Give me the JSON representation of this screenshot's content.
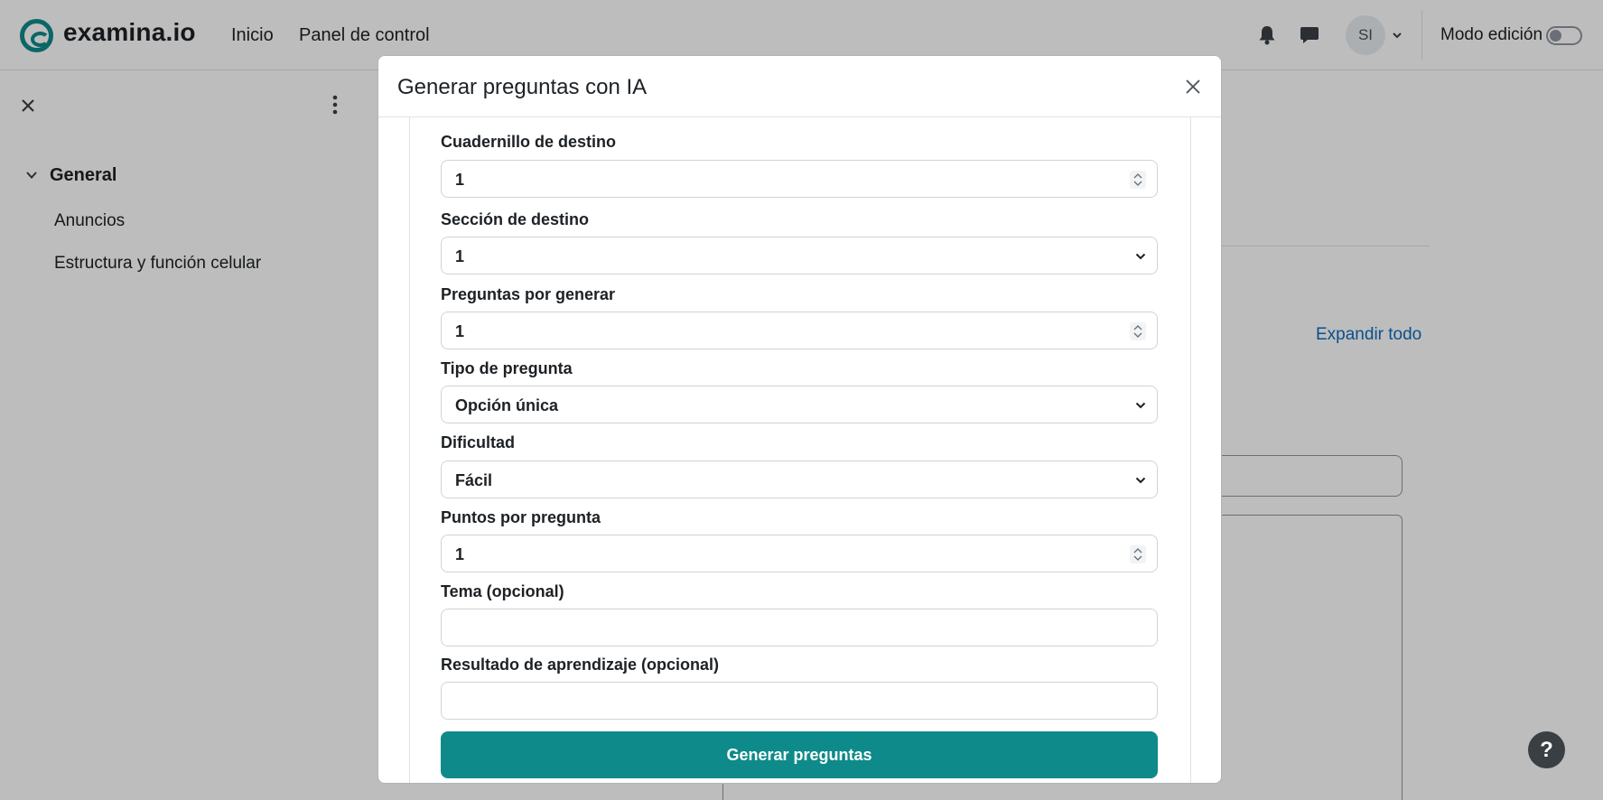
{
  "navbar": {
    "brand": "examina.io",
    "links": [
      "Inicio",
      "Panel de control"
    ],
    "avatar_initials": "SI",
    "edit_mode_label": "Modo edición",
    "accent_color": "#0f8a8a"
  },
  "drawer": {
    "section_title": "General",
    "items": [
      "Anuncios",
      "Estructura y función celular"
    ]
  },
  "page": {
    "expand_all": "Expandir todo"
  },
  "modal": {
    "title": "Generar preguntas con IA",
    "fields": [
      {
        "label": "Cuadernillo de destino",
        "type": "number",
        "value": "1"
      },
      {
        "label": "Sección de destino",
        "type": "select",
        "value": "1"
      },
      {
        "label": "Preguntas por generar",
        "type": "number",
        "value": "1"
      },
      {
        "label": "Tipo de pregunta",
        "type": "select",
        "value": "Opción única"
      },
      {
        "label": "Dificultad",
        "type": "select",
        "value": "Fácil"
      },
      {
        "label": "Puntos por pregunta",
        "type": "number",
        "value": "1"
      },
      {
        "label": "Tema (opcional)",
        "type": "text",
        "value": ""
      },
      {
        "label": "Resultado de aprendizaje (opcional)",
        "type": "text",
        "value": ""
      }
    ],
    "submit_label": "Generar preguntas"
  },
  "help_label": "?"
}
